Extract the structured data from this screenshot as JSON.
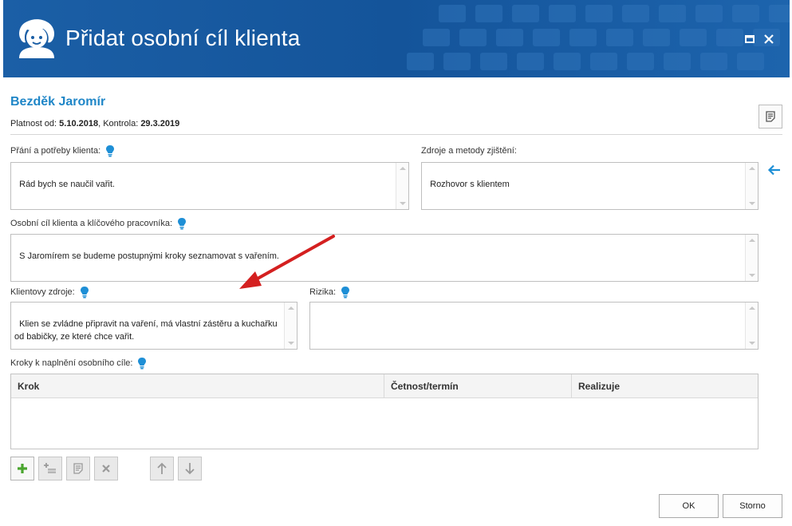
{
  "window": {
    "title": "Přidat osobní cíl klienta",
    "logo_icon": "client-face-logo",
    "maximize_icon": "maximize-icon",
    "close_icon": "close-icon",
    "title_bg_color": "#1a5ea5"
  },
  "client": {
    "name": "Bezděk Jaromír",
    "validity_label": "Platnost od:",
    "validity_value": "5.10.2018",
    "separator": ",",
    "control_label": "Kontrola:",
    "control_value": "29.3.2019",
    "accent_color": "#1f86c7"
  },
  "fields": {
    "wishes": {
      "label": "Přání a potřeby klienta:",
      "value": "Rád bych se naučil vařit."
    },
    "sources_methods": {
      "label": "Zdroje a metody zjištění:",
      "value": "Rozhovor s klientem"
    },
    "goal": {
      "label": "Osobní cíl klienta a klíčového pracovníka:",
      "value": "S Jaromírem se budeme postupnými kroky seznamovat s vařením."
    },
    "client_resources": {
      "label": "Klientovy zdroje:",
      "value": "Klien se zvládne připravit na vaření, má vlastní zástěru a kuchařku od babičky, ze které chce vařit."
    },
    "risks": {
      "label": "Rizika:",
      "value": ""
    },
    "steps": {
      "label": "Kroky k naplnění osobního cíle:"
    }
  },
  "steps_grid": {
    "columns": [
      "Krok",
      "Četnost/termín",
      "Realizuje"
    ],
    "rows": []
  },
  "toolbar": {
    "add_icon": "plus-icon",
    "insert_icon": "insert-row-icon",
    "edit_icon": "edit-note-icon",
    "delete_icon": "delete-icon",
    "move_up_icon": "arrow-up-icon",
    "move_down_icon": "arrow-down-icon"
  },
  "buttons": {
    "ok": "OK",
    "cancel": "Storno"
  },
  "colors": {
    "hint_bulb": "#1e8fd6",
    "add_green": "#4aa52e",
    "annotation_arrow": "#d42020"
  }
}
